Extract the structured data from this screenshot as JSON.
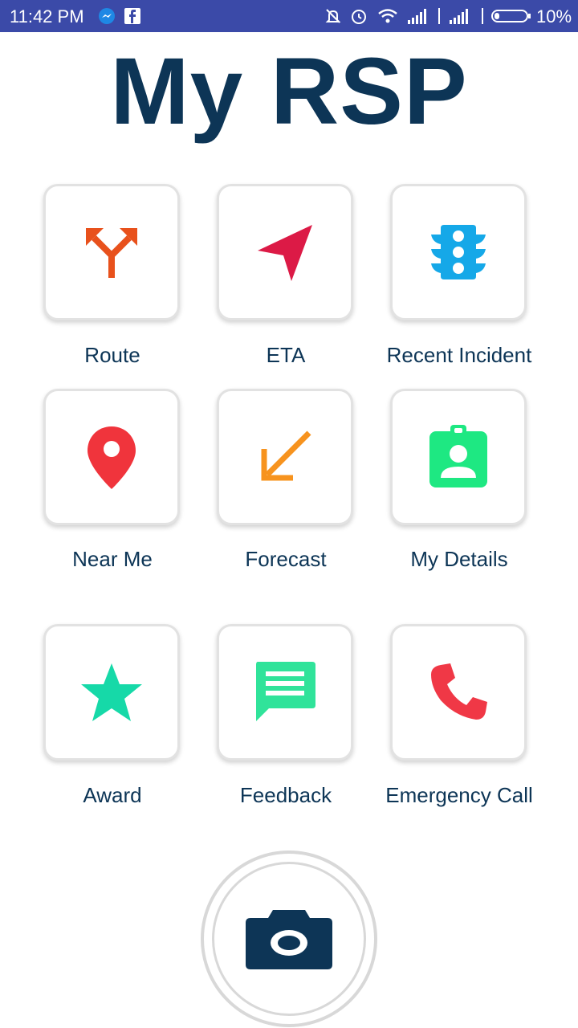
{
  "status_bar": {
    "time": "11:42 PM",
    "battery": "10%",
    "icons": [
      "messenger-icon",
      "facebook-icon",
      "mute-icon",
      "alarm-icon",
      "wifi-icon",
      "signal-icon",
      "signal-icon",
      "battery-icon"
    ]
  },
  "title": "My RSP",
  "tiles": [
    {
      "label": "Route",
      "icon": "route-split-icon",
      "color": "#e8511c"
    },
    {
      "label": "ETA",
      "icon": "navigation-arrow-icon",
      "color": "#dc1a46"
    },
    {
      "label": "Recent Incident",
      "icon": "traffic-light-icon",
      "color": "#15a8e8"
    },
    {
      "label": "Near Me",
      "icon": "map-pin-icon",
      "color": "#f0343c"
    },
    {
      "label": "Forecast",
      "icon": "arrow-down-left-icon",
      "color": "#f7931e"
    },
    {
      "label": "My Details",
      "icon": "id-badge-icon",
      "color": "#1ee882"
    },
    {
      "label": "Award",
      "icon": "star-icon",
      "color": "#16d9a8"
    },
    {
      "label": "Feedback",
      "icon": "chat-icon",
      "color": "#30e39a"
    },
    {
      "label": "Emergency Call",
      "icon": "phone-icon",
      "color": "#f03846"
    }
  ],
  "camera_button": {
    "icon": "camera-icon",
    "color": "#0d3556"
  }
}
